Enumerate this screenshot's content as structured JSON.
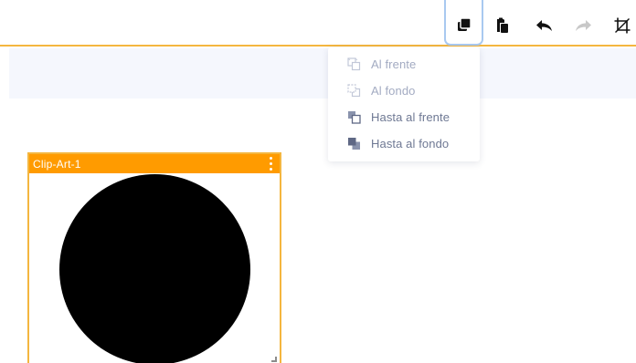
{
  "toolbar": {
    "buttons": [
      {
        "name": "arrange-icon",
        "active": true
      },
      {
        "name": "paste-icon"
      },
      {
        "name": "undo-icon"
      },
      {
        "name": "redo-icon",
        "disabled": true
      },
      {
        "name": "crop-icon"
      }
    ],
    "accent_color": "#f4b63f"
  },
  "arrange_menu": {
    "items": [
      {
        "label": "Al frente",
        "icon": "bring-forward-icon",
        "enabled": false
      },
      {
        "label": "Al fondo",
        "icon": "send-backward-icon",
        "enabled": false
      },
      {
        "label": "Hasta al frente",
        "icon": "bring-to-front-icon",
        "enabled": true
      },
      {
        "label": "Hasta al fondo",
        "icon": "send-to-back-icon",
        "enabled": true
      }
    ]
  },
  "clip_art": {
    "title": "Clip-Art-1",
    "header_color": "#ff9b00",
    "shape": "circle",
    "shape_color": "#000000"
  }
}
